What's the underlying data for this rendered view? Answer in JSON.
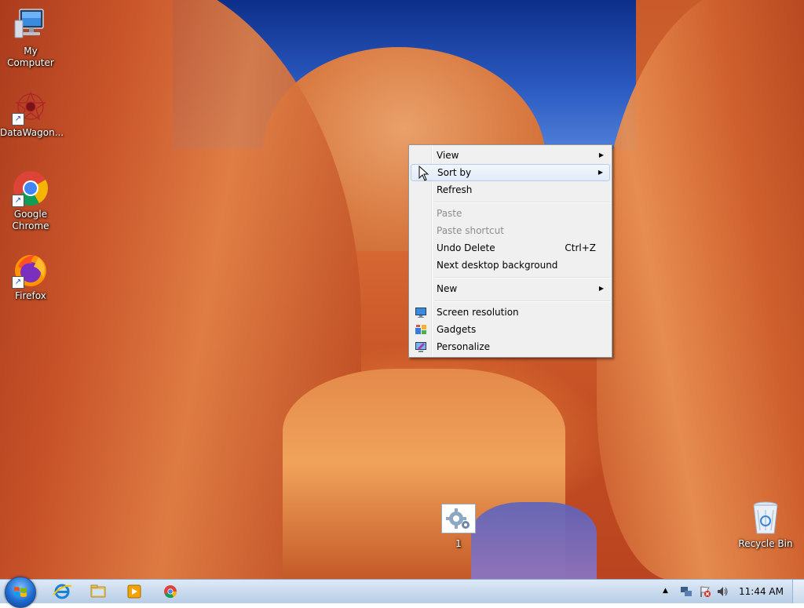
{
  "desktop": {
    "icons": [
      {
        "label": "My Computer",
        "icon": "computer-icon"
      },
      {
        "label": "DataWagon...",
        "icon": "datawagon-icon"
      },
      {
        "label": "Google Chrome",
        "icon": "chrome-icon"
      },
      {
        "label": "Firefox",
        "icon": "firefox-icon"
      },
      {
        "label": "1",
        "icon": "gear-settings-icon"
      },
      {
        "label": "Recycle Bin",
        "icon": "recycle-bin-icon"
      }
    ]
  },
  "context_menu": {
    "items": {
      "view": "View",
      "sort_by": "Sort by",
      "refresh": "Refresh",
      "paste": "Paste",
      "paste_shortcut": "Paste shortcut",
      "undo_delete": "Undo Delete",
      "undo_delete_shortcut": "Ctrl+Z",
      "next_background": "Next desktop background",
      "new": "New",
      "screen_resolution": "Screen resolution",
      "gadgets": "Gadgets",
      "personalize": "Personalize"
    },
    "hovered": "sort_by",
    "disabled": [
      "paste",
      "paste_shortcut"
    ]
  },
  "taskbar": {
    "start_icon": "windows-start-orb",
    "pinned": [
      "internet-explorer-icon",
      "file-explorer-icon",
      "media-player-icon",
      "chrome-icon"
    ],
    "tray_icons": [
      "show-hidden-icons-arrow",
      "network-icon",
      "action-center-flag-icon",
      "volume-icon"
    ],
    "clock": "11:44 AM"
  }
}
